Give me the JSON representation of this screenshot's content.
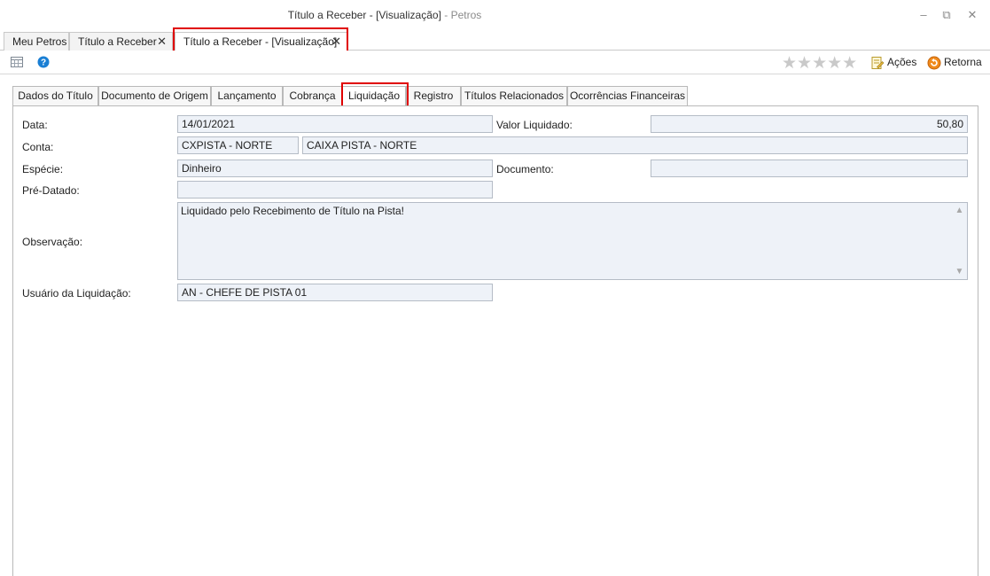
{
  "window": {
    "title": "Título a Receber - [Visualização]",
    "app_suffix": " - Petros",
    "minimize_glyph": "–",
    "restore_glyph": "⧉",
    "close_glyph": "✕"
  },
  "doc_tabs": [
    {
      "label": "Meu Petros",
      "closable": false
    },
    {
      "label": "Título a Receber",
      "closable": true,
      "close_glyph": "✕"
    },
    {
      "label": "Título a Receber - [Visualização]",
      "closable": true,
      "close_glyph": "✕",
      "active": true
    }
  ],
  "toolbar": {
    "icons": [
      "report-icon",
      "help-icon"
    ],
    "rating_stars": "★★★★★",
    "actions_label": "Ações",
    "return_label": "Retorna"
  },
  "content_tabs": [
    {
      "label": "Dados do Título"
    },
    {
      "label": "Documento de Origem"
    },
    {
      "label": "Lançamento"
    },
    {
      "label": "Cobrança"
    },
    {
      "label": "Liquidação",
      "active": true
    },
    {
      "label": "Registro"
    },
    {
      "label": "Títulos Relacionados"
    },
    {
      "label": "Ocorrências Financeiras"
    }
  ],
  "form": {
    "data_label": "Data:",
    "data_value": "14/01/2021",
    "valor_label": "Valor Liquidado:",
    "valor_value": "50,80",
    "conta_label": "Conta:",
    "conta_code": "CXPISTA - NORTE",
    "conta_name": "CAIXA PISTA - NORTE",
    "especie_label": "Espécie:",
    "especie_value": "Dinheiro",
    "documento_label": "Documento:",
    "documento_value": "",
    "predatado_label": "Pré-Datado:",
    "predatado_value": "",
    "observacao_label": "Observação:",
    "observacao_value": "Liquidado pelo Recebimento de Título na Pista!",
    "usuario_label": "Usuário da Liquidação:",
    "usuario_value": "AN - CHEFE DE PISTA 01"
  },
  "colors": {
    "highlight": "#e00000",
    "field_bg": "#eef2f8",
    "field_border": "#b5bcc6",
    "help_icon": "#1a7fd4"
  }
}
